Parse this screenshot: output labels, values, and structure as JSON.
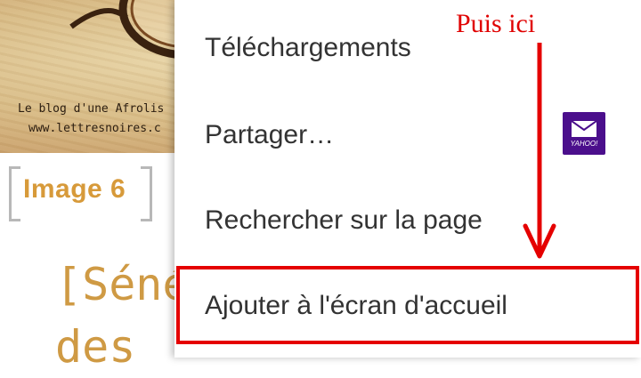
{
  "blog": {
    "photo_caption_line1": "Le blog d'une Afrolis",
    "photo_caption_line2": "www.lettresnoires.c",
    "image_label": "Image 6",
    "heading_line1": "[Séné",
    "heading_line2": "des "
  },
  "menu": {
    "items": [
      {
        "label": "Téléchargements"
      },
      {
        "label": "Partager…",
        "app_badge": "YAHOO!"
      },
      {
        "label": "Rechercher sur la page"
      },
      {
        "label": "Ajouter à l'écran d'accueil",
        "highlighted": true
      }
    ]
  },
  "annotation": {
    "text": "Puis ici",
    "color": "#e00000"
  },
  "colors": {
    "accent_orange": "#d79a3a",
    "highlight_red": "#e50000",
    "yahoo_purple": "#4b0f8c"
  }
}
